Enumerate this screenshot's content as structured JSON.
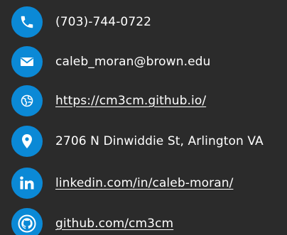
{
  "colors": {
    "background": "#2b2b2b",
    "icon_circle": "#0b89d6",
    "text": "#ffffff"
  },
  "contacts": [
    {
      "icon": "phone-icon",
      "text": "(703)-744-0722",
      "link": false
    },
    {
      "icon": "envelope-icon",
      "text": "caleb_moran@brown.edu",
      "link": false
    },
    {
      "icon": "globe-icon",
      "text": "https://cm3cm.github.io/",
      "link": true
    },
    {
      "icon": "map-pin-icon",
      "text": "2706 N Dinwiddie St, Arlington VA",
      "link": false
    },
    {
      "icon": "linkedin-icon",
      "text": "linkedin.com/in/caleb-moran/",
      "link": true
    },
    {
      "icon": "github-icon",
      "text": "github.com/cm3cm",
      "link": true
    }
  ]
}
